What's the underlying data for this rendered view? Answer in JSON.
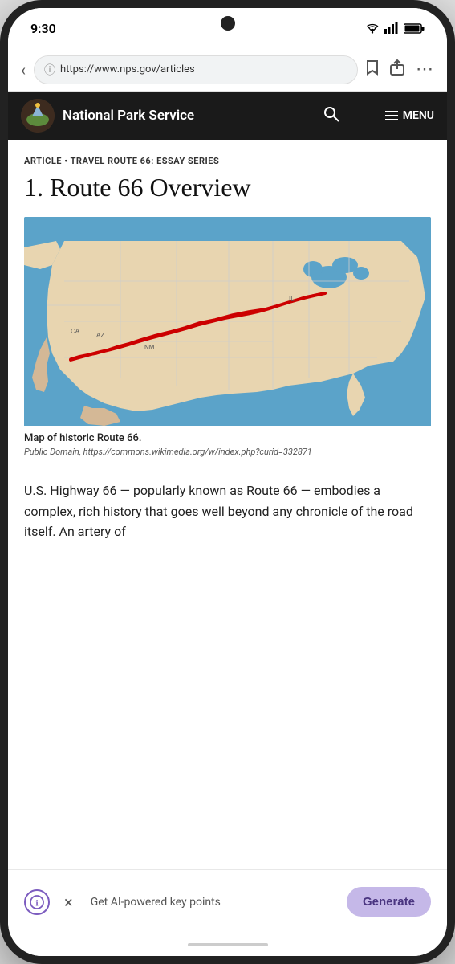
{
  "statusBar": {
    "time": "9:30"
  },
  "browserBar": {
    "backLabel": "‹",
    "url": "https://www.nps.gov/articles",
    "bookmarkIcon": "bookmark",
    "shareIcon": "share",
    "moreIcon": "more"
  },
  "npsNav": {
    "logoAlt": "NPS arrowhead logo",
    "title": "National Park Service",
    "searchIcon": "search",
    "menuLabel": "MENU"
  },
  "article": {
    "tag": "ARTICLE • TRAVEL ROUTE 66: ESSAY SERIES",
    "title": "1. Route 66 Overview",
    "mapCaption": "Map of historic Route 66.",
    "mapCredit": "Public Domain, https://commons.wikimedia.org/w/index.php?curid=332871",
    "bodyText": "U.S. Highway 66 — popularly known as Route 66 — embodies a complex, rich history that goes well beyond any chronicle of the road itself. An artery of"
  },
  "bottomBar": {
    "label": "Get AI-powered key points",
    "generateLabel": "Generate",
    "closeIcon": "×"
  }
}
